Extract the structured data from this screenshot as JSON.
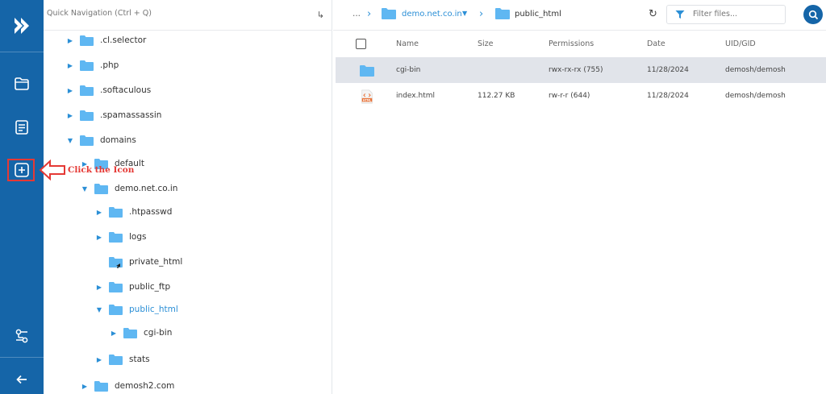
{
  "quick_nav": {
    "placeholder": "Quick Navigation (Ctrl + Q)"
  },
  "tree": {
    "nodes": [
      {
        "label": ".cl.selector",
        "expanded": false
      },
      {
        "label": ".php",
        "expanded": false
      },
      {
        "label": ".softaculous",
        "expanded": false
      },
      {
        "label": ".spamassassin",
        "expanded": false
      },
      {
        "label": "domains",
        "expanded": true
      },
      {
        "label": "default",
        "expanded": false
      },
      {
        "label": "demo.net.co.in",
        "expanded": true
      },
      {
        "label": ".htpasswd",
        "expanded": false
      },
      {
        "label": "logs",
        "expanded": false
      },
      {
        "label": "private_html",
        "expanded": false
      },
      {
        "label": "public_ftp",
        "expanded": false
      },
      {
        "label": "public_html",
        "expanded": true,
        "active": true
      },
      {
        "label": "cgi-bin",
        "expanded": false
      },
      {
        "label": "stats",
        "expanded": false
      },
      {
        "label": "demosh2.com",
        "expanded": false
      }
    ]
  },
  "annotation": {
    "text": "Click the Icon"
  },
  "breadcrumb": {
    "ellipsis": "...",
    "parent": "demo.net.co.in",
    "current": "public_html"
  },
  "filter": {
    "placeholder": "Filter files..."
  },
  "table": {
    "headers": {
      "name": "Name",
      "size": "Size",
      "permissions": "Permissions",
      "date": "Date",
      "uid": "UID/GID"
    },
    "rows": [
      {
        "name": "cgi-bin",
        "size": "",
        "permissions": "rwx-rx-rx (755)",
        "date": "11/28/2024",
        "uid": "demosh/demosh",
        "icon": "folder-icon",
        "selected": true
      },
      {
        "name": "index.html",
        "size": "112.27 KB",
        "permissions": "rw-r-r (644)",
        "date": "11/28/2024",
        "uid": "demosh/demosh",
        "icon": "html-file-icon",
        "selected": false
      }
    ]
  },
  "colors": {
    "rail": "#1565a8",
    "accent": "#2b8fd6",
    "folder": "#5fb7f2",
    "annotation": "#e53935",
    "selected_row": "#e1e4ea"
  }
}
